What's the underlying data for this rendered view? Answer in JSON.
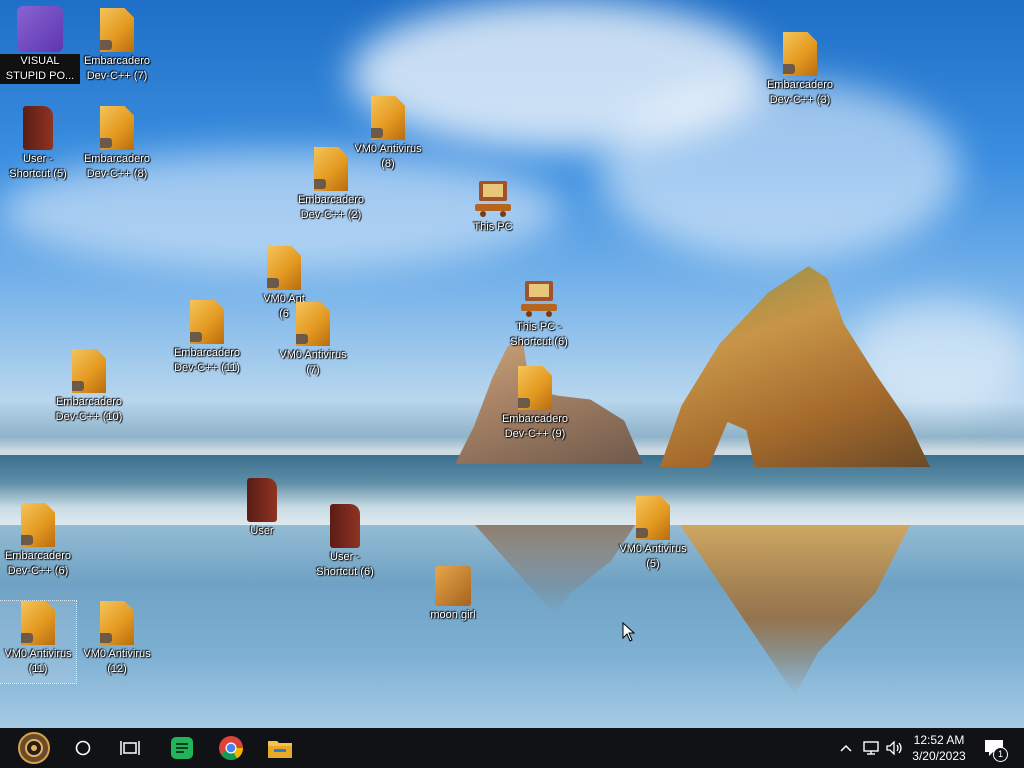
{
  "desktop_icons": [
    {
      "label": "VISUAL\nSTUPID PO...",
      "type": "vs"
    },
    {
      "label": "Embarcadero\nDev-C++ (7)",
      "type": "file"
    },
    {
      "label": "User -\nShortcut (5)",
      "type": "door"
    },
    {
      "label": "Embarcadero\nDev-C++ (8)",
      "type": "file"
    },
    {
      "label": "VM0 Antivirus\n(8)",
      "type": "file"
    },
    {
      "label": "Embarcadero\nDev-C++ (2)",
      "type": "file"
    },
    {
      "label": "This PC",
      "type": "pc"
    },
    {
      "label": "VM0 Ant\n(6",
      "type": "file"
    },
    {
      "label": "VM0 Antivirus\n(7)",
      "type": "file"
    },
    {
      "label": "Embarcadero\nDev-C++ (11)",
      "type": "file"
    },
    {
      "label": "This PC -\nShortcut (6)",
      "type": "pc"
    },
    {
      "label": "Embarcadero\nDev-C++ (10)",
      "type": "file"
    },
    {
      "label": "Embarcadero\nDev-C++ (9)",
      "type": "file"
    },
    {
      "label": "Embarcadero\nDev-C++ (3)",
      "type": "file"
    },
    {
      "label": "User",
      "type": "door"
    },
    {
      "label": "User -\nShortcut (6)",
      "type": "door"
    },
    {
      "label": "VM0 Antivirus\n(5)",
      "type": "file"
    },
    {
      "label": "Embarcadero\nDev-C++ (6)",
      "type": "file"
    },
    {
      "label": "moon girl",
      "type": "box"
    },
    {
      "label": "VM0 Antivirus\n(11)",
      "type": "file"
    },
    {
      "label": "VM0 Antivirus\n(12)",
      "type": "file"
    }
  ],
  "taskbar": {
    "start_icon": "steampunk-gear-icon",
    "search_icon": "circle-search-icon",
    "taskview_icon": "task-view-icon",
    "pinned": [
      "notes-app-icon",
      "chrome-icon",
      "file-explorer-icon"
    ],
    "tray": {
      "time": "12:52 AM",
      "date": "3/20/2023",
      "notification_count": "1"
    }
  },
  "colors": {
    "taskbar_bg": "#101216",
    "accent_green": "#21b45b"
  }
}
